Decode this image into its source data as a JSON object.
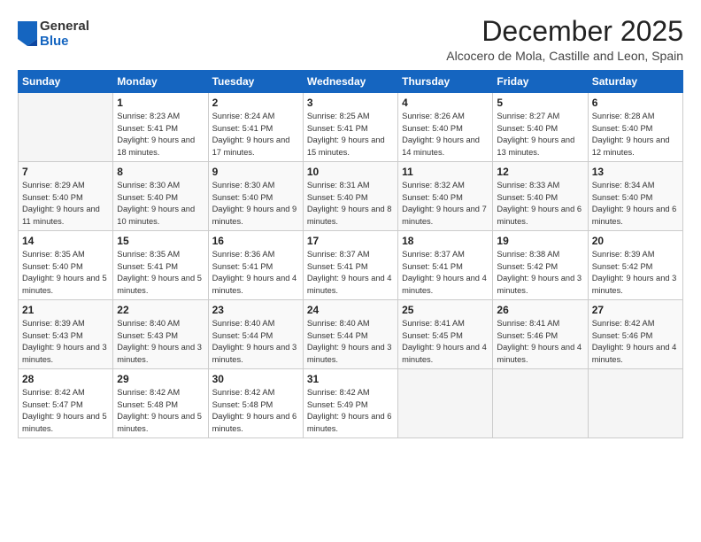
{
  "logo": {
    "general": "General",
    "blue": "Blue"
  },
  "title": "December 2025",
  "subtitle": "Alcocero de Mola, Castille and Leon, Spain",
  "days": [
    "Sunday",
    "Monday",
    "Tuesday",
    "Wednesday",
    "Thursday",
    "Friday",
    "Saturday"
  ],
  "weeks": [
    [
      {
        "num": "",
        "sunrise": "",
        "sunset": "",
        "daylight": "",
        "empty": true
      },
      {
        "num": "1",
        "sunrise": "Sunrise: 8:23 AM",
        "sunset": "Sunset: 5:41 PM",
        "daylight": "Daylight: 9 hours and 18 minutes."
      },
      {
        "num": "2",
        "sunrise": "Sunrise: 8:24 AM",
        "sunset": "Sunset: 5:41 PM",
        "daylight": "Daylight: 9 hours and 17 minutes."
      },
      {
        "num": "3",
        "sunrise": "Sunrise: 8:25 AM",
        "sunset": "Sunset: 5:41 PM",
        "daylight": "Daylight: 9 hours and 15 minutes."
      },
      {
        "num": "4",
        "sunrise": "Sunrise: 8:26 AM",
        "sunset": "Sunset: 5:40 PM",
        "daylight": "Daylight: 9 hours and 14 minutes."
      },
      {
        "num": "5",
        "sunrise": "Sunrise: 8:27 AM",
        "sunset": "Sunset: 5:40 PM",
        "daylight": "Daylight: 9 hours and 13 minutes."
      },
      {
        "num": "6",
        "sunrise": "Sunrise: 8:28 AM",
        "sunset": "Sunset: 5:40 PM",
        "daylight": "Daylight: 9 hours and 12 minutes."
      }
    ],
    [
      {
        "num": "7",
        "sunrise": "Sunrise: 8:29 AM",
        "sunset": "Sunset: 5:40 PM",
        "daylight": "Daylight: 9 hours and 11 minutes."
      },
      {
        "num": "8",
        "sunrise": "Sunrise: 8:30 AM",
        "sunset": "Sunset: 5:40 PM",
        "daylight": "Daylight: 9 hours and 10 minutes."
      },
      {
        "num": "9",
        "sunrise": "Sunrise: 8:30 AM",
        "sunset": "Sunset: 5:40 PM",
        "daylight": "Daylight: 9 hours and 9 minutes."
      },
      {
        "num": "10",
        "sunrise": "Sunrise: 8:31 AM",
        "sunset": "Sunset: 5:40 PM",
        "daylight": "Daylight: 9 hours and 8 minutes."
      },
      {
        "num": "11",
        "sunrise": "Sunrise: 8:32 AM",
        "sunset": "Sunset: 5:40 PM",
        "daylight": "Daylight: 9 hours and 7 minutes."
      },
      {
        "num": "12",
        "sunrise": "Sunrise: 8:33 AM",
        "sunset": "Sunset: 5:40 PM",
        "daylight": "Daylight: 9 hours and 6 minutes."
      },
      {
        "num": "13",
        "sunrise": "Sunrise: 8:34 AM",
        "sunset": "Sunset: 5:40 PM",
        "daylight": "Daylight: 9 hours and 6 minutes."
      }
    ],
    [
      {
        "num": "14",
        "sunrise": "Sunrise: 8:35 AM",
        "sunset": "Sunset: 5:40 PM",
        "daylight": "Daylight: 9 hours and 5 minutes."
      },
      {
        "num": "15",
        "sunrise": "Sunrise: 8:35 AM",
        "sunset": "Sunset: 5:41 PM",
        "daylight": "Daylight: 9 hours and 5 minutes."
      },
      {
        "num": "16",
        "sunrise": "Sunrise: 8:36 AM",
        "sunset": "Sunset: 5:41 PM",
        "daylight": "Daylight: 9 hours and 4 minutes."
      },
      {
        "num": "17",
        "sunrise": "Sunrise: 8:37 AM",
        "sunset": "Sunset: 5:41 PM",
        "daylight": "Daylight: 9 hours and 4 minutes."
      },
      {
        "num": "18",
        "sunrise": "Sunrise: 8:37 AM",
        "sunset": "Sunset: 5:41 PM",
        "daylight": "Daylight: 9 hours and 4 minutes."
      },
      {
        "num": "19",
        "sunrise": "Sunrise: 8:38 AM",
        "sunset": "Sunset: 5:42 PM",
        "daylight": "Daylight: 9 hours and 3 minutes."
      },
      {
        "num": "20",
        "sunrise": "Sunrise: 8:39 AM",
        "sunset": "Sunset: 5:42 PM",
        "daylight": "Daylight: 9 hours and 3 minutes."
      }
    ],
    [
      {
        "num": "21",
        "sunrise": "Sunrise: 8:39 AM",
        "sunset": "Sunset: 5:43 PM",
        "daylight": "Daylight: 9 hours and 3 minutes."
      },
      {
        "num": "22",
        "sunrise": "Sunrise: 8:40 AM",
        "sunset": "Sunset: 5:43 PM",
        "daylight": "Daylight: 9 hours and 3 minutes."
      },
      {
        "num": "23",
        "sunrise": "Sunrise: 8:40 AM",
        "sunset": "Sunset: 5:44 PM",
        "daylight": "Daylight: 9 hours and 3 minutes."
      },
      {
        "num": "24",
        "sunrise": "Sunrise: 8:40 AM",
        "sunset": "Sunset: 5:44 PM",
        "daylight": "Daylight: 9 hours and 3 minutes."
      },
      {
        "num": "25",
        "sunrise": "Sunrise: 8:41 AM",
        "sunset": "Sunset: 5:45 PM",
        "daylight": "Daylight: 9 hours and 4 minutes."
      },
      {
        "num": "26",
        "sunrise": "Sunrise: 8:41 AM",
        "sunset": "Sunset: 5:46 PM",
        "daylight": "Daylight: 9 hours and 4 minutes."
      },
      {
        "num": "27",
        "sunrise": "Sunrise: 8:42 AM",
        "sunset": "Sunset: 5:46 PM",
        "daylight": "Daylight: 9 hours and 4 minutes."
      }
    ],
    [
      {
        "num": "28",
        "sunrise": "Sunrise: 8:42 AM",
        "sunset": "Sunset: 5:47 PM",
        "daylight": "Daylight: 9 hours and 5 minutes."
      },
      {
        "num": "29",
        "sunrise": "Sunrise: 8:42 AM",
        "sunset": "Sunset: 5:48 PM",
        "daylight": "Daylight: 9 hours and 5 minutes."
      },
      {
        "num": "30",
        "sunrise": "Sunrise: 8:42 AM",
        "sunset": "Sunset: 5:48 PM",
        "daylight": "Daylight: 9 hours and 6 minutes."
      },
      {
        "num": "31",
        "sunrise": "Sunrise: 8:42 AM",
        "sunset": "Sunset: 5:49 PM",
        "daylight": "Daylight: 9 hours and 6 minutes."
      },
      {
        "num": "",
        "sunrise": "",
        "sunset": "",
        "daylight": "",
        "empty": true
      },
      {
        "num": "",
        "sunrise": "",
        "sunset": "",
        "daylight": "",
        "empty": true
      },
      {
        "num": "",
        "sunrise": "",
        "sunset": "",
        "daylight": "",
        "empty": true
      }
    ]
  ]
}
